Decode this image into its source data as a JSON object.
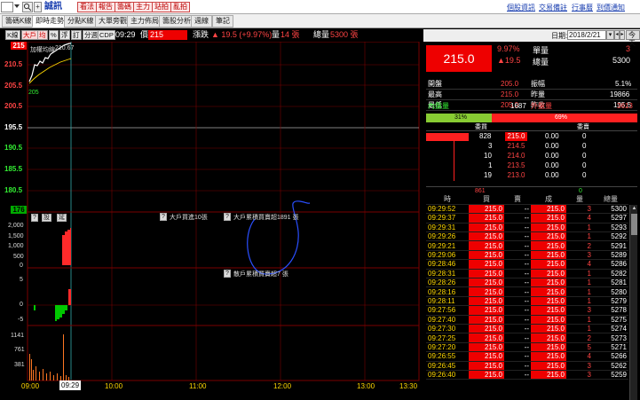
{
  "topbar": {
    "stock_name": "誠訊",
    "search_icon": "search-icon",
    "add_symbol": "+",
    "red_buttons": [
      "看法",
      "報告",
      "籌碼",
      "主力",
      "站拍",
      "亂拍"
    ],
    "links": [
      "個股資訊",
      "交易備註",
      "行事曆",
      "到價通知"
    ]
  },
  "tabs": [
    "籌碼K線",
    "即時走勢",
    "分點K線",
    "大單旁觀",
    "主力佈局",
    "籌股分析",
    "週線",
    "筆記"
  ],
  "chart_toolbar": {
    "buttons": [
      "K線",
      "大戶",
      "均",
      "%",
      "浮",
      "訂",
      "分週",
      "CDP"
    ],
    "time": "09:29",
    "price_label": "價",
    "price": "215",
    "change_label": "漲跌",
    "change": "▲ 19.5 (+9.97%)",
    "volume_label": "量",
    "volume": "14 張",
    "total_label": "總量",
    "total": "5300 張"
  },
  "chart": {
    "top_price_marker": "215",
    "bottom_price_marker": "176",
    "price_axis": [
      "210.5",
      "205.5",
      "200.5",
      "195.5",
      "190.5",
      "185.5",
      "180.5"
    ],
    "legend_avg_label": "加權均線",
    "legend_avg_value": "210.67",
    "low_label": "205",
    "mid_buttons": [
      "?",
      "設",
      "延"
    ],
    "ann_buy": "大戶買進10張",
    "ann_cum": "大戶累積買賣超1891 張",
    "ann_net": "散戶累積買賣超7 張",
    "vol_axis_1": [
      "2,000",
      "1,500",
      "1,000",
      "500",
      "0"
    ],
    "vol_axis_2": [
      "5",
      "0",
      "-5"
    ],
    "vol_axis_3": [
      "1141",
      "761",
      "381"
    ],
    "time_axis": [
      "09:00",
      "10:00",
      "11:00",
      "12:00",
      "13:00",
      "13:30"
    ],
    "cursor_time": "09:29"
  },
  "right_panel": {
    "date_label": "日期:",
    "date": "2018/2/21",
    "today_btn": "今天",
    "price_big": "215.0",
    "pct": "9.97%",
    "chg": "▲19.5",
    "single_label": "單量",
    "single": "3",
    "total_label": "總量",
    "total": "5300",
    "rows": [
      {
        "l1": "開盤",
        "v1": "205.0",
        "l2": "振幅",
        "v2": "5.1%"
      },
      {
        "l1": "最高",
        "v1": "215.0",
        "l2": "昨量",
        "v2": "19866"
      },
      {
        "l1": "最低",
        "v1": "205.0",
        "l2": "昨收",
        "v2": "195.5"
      }
    ],
    "inner_label": "內盤量",
    "inner": "1687",
    "outer_label": "外盤量",
    "outer": "3613",
    "inner_pct": "31%",
    "outer_pct": "69%",
    "inner_frac": 0.31,
    "buy_hdr": "委買",
    "sell_hdr": "委賣",
    "book": [
      {
        "qty": "828",
        "price": "215.0",
        "s1": "0.00",
        "s2": "0"
      },
      {
        "qty": "3",
        "price": "214.5",
        "s1": "0.00",
        "s2": "0"
      },
      {
        "qty": "10",
        "price": "214.0",
        "s1": "0.00",
        "s2": "0"
      },
      {
        "qty": "1",
        "price": "213.5",
        "s1": "0.00",
        "s2": "0"
      },
      {
        "qty": "19",
        "price": "213.0",
        "s1": "0.00",
        "s2": "0"
      }
    ],
    "book_total_left": "861",
    "book_total_right": "0",
    "trade_headers": [
      "時",
      "買",
      "賣",
      "成",
      "量",
      "總量"
    ],
    "trades": [
      [
        "09:29:52",
        "215.0",
        "--",
        "215.0",
        "3",
        "5300"
      ],
      [
        "09:29:37",
        "215.0",
        "--",
        "215.0",
        "4",
        "5297"
      ],
      [
        "09:29:31",
        "215.0",
        "--",
        "215.0",
        "1",
        "5293"
      ],
      [
        "09:29:26",
        "215.0",
        "--",
        "215.0",
        "1",
        "5292"
      ],
      [
        "09:29:21",
        "215.0",
        "--",
        "215.0",
        "2",
        "5291"
      ],
      [
        "09:29:06",
        "215.0",
        "--",
        "215.0",
        "3",
        "5289"
      ],
      [
        "09:28:46",
        "215.0",
        "--",
        "215.0",
        "4",
        "5286"
      ],
      [
        "09:28:31",
        "215.0",
        "--",
        "215.0",
        "1",
        "5282"
      ],
      [
        "09:28:26",
        "215.0",
        "--",
        "215.0",
        "1",
        "5281"
      ],
      [
        "09:28:16",
        "215.0",
        "--",
        "215.0",
        "1",
        "5280"
      ],
      [
        "09:28:11",
        "215.0",
        "--",
        "215.0",
        "1",
        "5279"
      ],
      [
        "09:27:56",
        "215.0",
        "--",
        "215.0",
        "3",
        "5278"
      ],
      [
        "09:27:40",
        "215.0",
        "--",
        "215.0",
        "1",
        "5275"
      ],
      [
        "09:27:30",
        "215.0",
        "--",
        "215.0",
        "1",
        "5274"
      ],
      [
        "09:27:25",
        "215.0",
        "--",
        "215.0",
        "2",
        "5273"
      ],
      [
        "09:27:20",
        "215.0",
        "--",
        "215.0",
        "5",
        "5271"
      ],
      [
        "09:26:55",
        "215.0",
        "--",
        "215.0",
        "4",
        "5266"
      ],
      [
        "09:26:45",
        "215.0",
        "--",
        "215.0",
        "3",
        "5262"
      ],
      [
        "09:26:40",
        "215.0",
        "--",
        "215.0",
        "3",
        "5259"
      ]
    ]
  },
  "colors": {
    "up": "#ff3030",
    "down": "#00cc00",
    "avg": "#ffd800",
    "grid": "#7a0000"
  }
}
